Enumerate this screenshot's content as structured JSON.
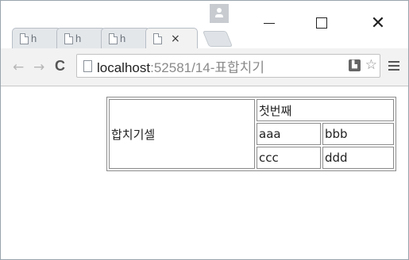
{
  "browser": {
    "tabs": [
      {
        "title": "h",
        "icon": "page-icon"
      },
      {
        "title": "h",
        "icon": "page-icon"
      },
      {
        "title": "h",
        "icon": "page-icon"
      },
      {
        "title": "",
        "icon": "page-icon",
        "close": "×",
        "active": true
      }
    ],
    "window_controls": {
      "minimize": "—",
      "maximize": "☐",
      "close": "✕"
    },
    "address": {
      "host": "localhost",
      "path": ":52581/14-표합치기"
    },
    "nav": {
      "back": "←",
      "forward": "→",
      "reload": "C"
    }
  },
  "table": {
    "merged_cell": "합치기셀",
    "header_cell": "첫번째",
    "rows": [
      [
        "aaa",
        "bbb"
      ],
      [
        "ccc",
        "ddd"
      ]
    ]
  }
}
